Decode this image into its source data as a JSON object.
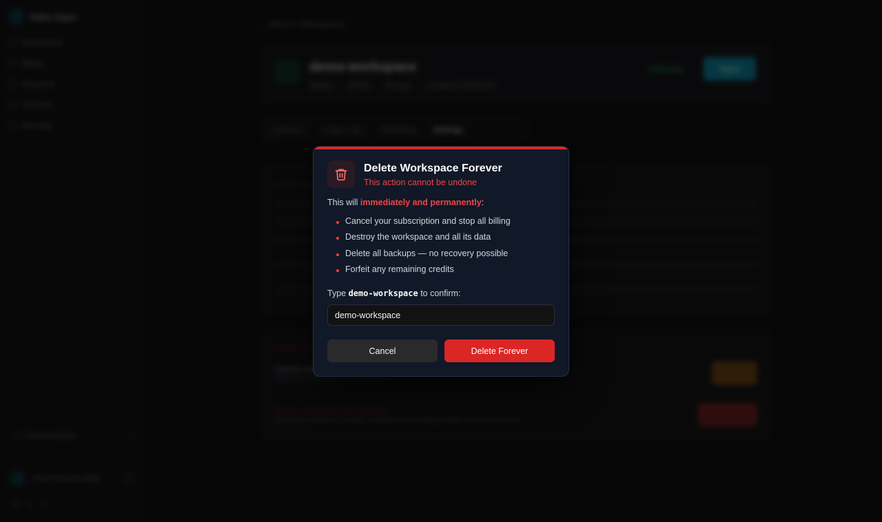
{
  "sidebar": {
    "brand": "Daku Apps",
    "items": [
      {
        "label": "Dashboard",
        "icon": "grid-icon"
      },
      {
        "label": "Billing",
        "icon": "card-icon"
      },
      {
        "label": "Payment",
        "icon": "wallet-icon"
      },
      {
        "label": "Account",
        "icon": "user-icon"
      },
      {
        "label": "Security",
        "icon": "shield-icon"
      }
    ],
    "docs_label": "Documentation",
    "user_label": "Vinod Ramesh Alder"
  },
  "main": {
    "back_label": "Back to Workspaces",
    "workspace": {
      "name": "demo-workspace",
      "meta": [
        "Starter",
        "$7/Mo",
        "Europe",
        "Created 17/05/2025"
      ],
      "status": "Running",
      "open_label": "Open"
    },
    "tabs": [
      {
        "label": "Overview"
      },
      {
        "label": "Usage Logs"
      },
      {
        "label": "Monitoring"
      },
      {
        "label": "Settings"
      }
    ],
    "subscription": {
      "title": "Subscription",
      "plan_label": "Plan",
      "plan_value": "Starter · $7/Mo",
      "renewal_label": "Renewal date",
      "renewal_value": "17/06/2025",
      "cycle_label": "Billing period",
      "cycle_value": "Monthly"
    },
    "danger": {
      "title": "Danger Zone",
      "cancel_title": "Cancel subscription",
      "cancel_sub": "Stop future billing for this workspace",
      "cancel_btn": "Cancel",
      "delete_title": "Delete workspace permanently",
      "delete_sub": "Immediately destroys. All data, backups and remaining credits will be lost forever.",
      "delete_btn": "Delete"
    }
  },
  "modal": {
    "title": "Delete Workspace Forever",
    "subtitle": "This action cannot be undone",
    "warning_prefix": "This will ",
    "warning_emphasis": "immediately and permanently",
    "warning_suffix": ":",
    "consequences": [
      "Cancel your subscription and stop all billing",
      "Destroy the workspace and all its data",
      "Delete all backups — no recovery possible",
      "Forfeit any remaining credits"
    ],
    "confirm_prefix": "Type ",
    "confirm_code": "demo-workspace",
    "confirm_suffix": " to confirm:",
    "input_value": "demo-workspace",
    "cancel_label": "Cancel",
    "delete_label": "Delete Forever",
    "colors": {
      "accent": "#dc2626",
      "danger_text": "#ef4444",
      "background": "#111827"
    }
  }
}
